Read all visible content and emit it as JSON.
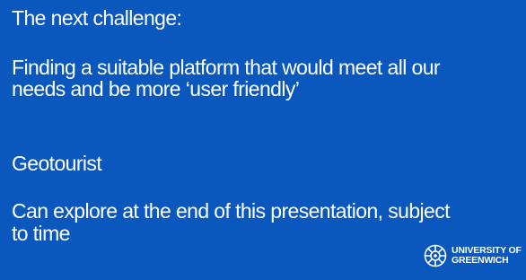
{
  "background_color": "#0a57bd",
  "text_color": "#ffffff",
  "slide": {
    "heading": "The next challenge:",
    "paragraph_lines": [
      "Finding a suitable platform that would meet all our",
      "needs and be more ‘user friendly’"
    ],
    "platform_name": "Geotourist",
    "note_lines": [
      "Can explore at the end of this presentation, subject",
      "to time"
    ]
  },
  "logo": {
    "icon": "university-emblem-icon",
    "line1": "UNIVERSITY OF",
    "line2": "GREENWICH"
  }
}
